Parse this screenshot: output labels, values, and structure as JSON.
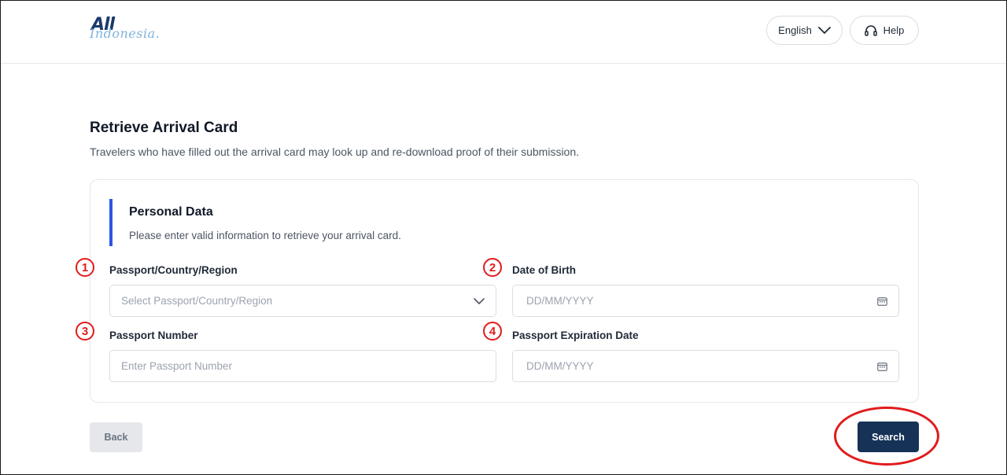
{
  "header": {
    "logo": {
      "line1": "All",
      "line2": "Indonesia."
    },
    "language_label": "English",
    "help_label": "Help"
  },
  "page": {
    "title": "Retrieve Arrival Card",
    "description": "Travelers who have filled out the arrival card may look up and re-download proof of their submission."
  },
  "section": {
    "title": "Personal Data",
    "description": "Please enter valid information to retrieve your arrival card.",
    "accent_color": "#2d55e6"
  },
  "form": {
    "passport_country": {
      "marker": "1",
      "label": "Passport/Country/Region",
      "placeholder": "Select Passport/Country/Region"
    },
    "date_of_birth": {
      "marker": "2",
      "label": "Date of Birth",
      "placeholder": "DD/MM/YYYY"
    },
    "passport_number": {
      "marker": "3",
      "label": "Passport Number",
      "placeholder": "Enter Passport Number"
    },
    "passport_expiration": {
      "marker": "4",
      "label": "Passport Expiration Date",
      "placeholder": "DD/MM/YYYY"
    }
  },
  "actions": {
    "back_label": "Back",
    "search_label": "Search"
  },
  "colors": {
    "primary_button": "#163257",
    "annotation": "#e11b1b"
  },
  "icons": [
    "chevron-down-icon",
    "headset-icon",
    "calendar-icon"
  ]
}
